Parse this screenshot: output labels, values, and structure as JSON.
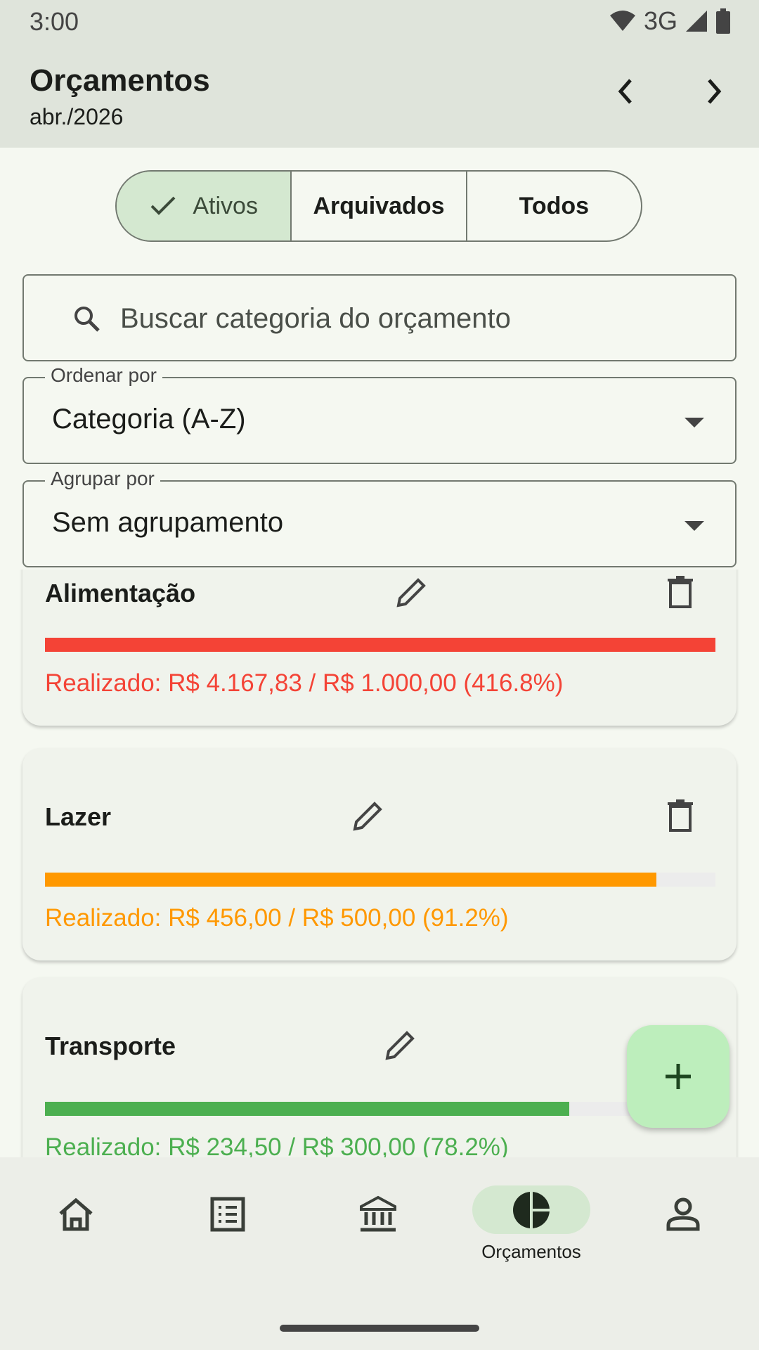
{
  "status": {
    "time": "3:00",
    "network": "3G"
  },
  "header": {
    "title": "Orçamentos",
    "period": "abr./2026"
  },
  "filter_tabs": [
    {
      "label": "Ativos",
      "selected": true
    },
    {
      "label": "Arquivados",
      "selected": false
    },
    {
      "label": "Todos",
      "selected": false
    }
  ],
  "search": {
    "placeholder": "Buscar categoria do orçamento"
  },
  "sort": {
    "label": "Ordenar por",
    "value": "Categoria (A-Z)"
  },
  "group": {
    "label": "Agrupar por",
    "value": "Sem agrupamento"
  },
  "budgets": [
    {
      "category": "Alimentação",
      "progress": 1.0,
      "text": "Realizado: R$ 4.167,83 / R$ 1.000,00 (416.8%)",
      "color": "#f44336"
    },
    {
      "category": "Lazer",
      "progress": 0.912,
      "text": "Realizado: R$ 456,00 / R$ 500,00 (91.2%)",
      "color": "#ff9800"
    },
    {
      "category": "Transporte",
      "progress": 0.782,
      "text": "Realizado: R$ 234,50 / R$ 300,00 (78.2%)",
      "color": "#4caf50"
    }
  ],
  "bottom_nav": {
    "items": [
      {
        "icon": "home-icon",
        "label": "",
        "active": false
      },
      {
        "icon": "list-icon",
        "label": "",
        "active": false
      },
      {
        "icon": "bank-icon",
        "label": "",
        "active": false
      },
      {
        "icon": "pie-chart-icon",
        "label": "Orçamentos",
        "active": true
      },
      {
        "icon": "person-icon",
        "label": "",
        "active": false
      }
    ]
  },
  "colors": {
    "accent": "#d4e8d0",
    "fab": "#bdeebc",
    "appbar": "#dfe4db"
  }
}
